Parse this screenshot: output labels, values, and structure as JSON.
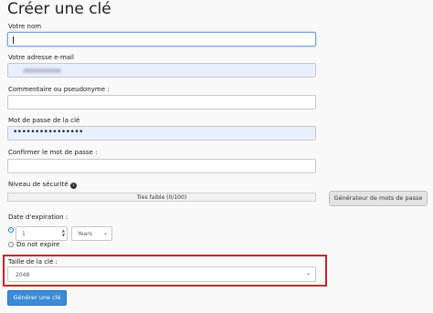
{
  "page_title": "Créer une clé",
  "name": {
    "label": "Votre nom",
    "value": ""
  },
  "email": {
    "label": "Votre adresse e-mail"
  },
  "comment": {
    "label": "Commentaire ou pseudonyme :",
    "value": ""
  },
  "passphrase": {
    "label": "Mot de passe de la clé",
    "masked": "••••••••••••••••"
  },
  "confirm": {
    "label": "Confirmer le mot de passe :",
    "value": ""
  },
  "security": {
    "label": "Niveau de sécurité",
    "info_icon": "info-icon",
    "strength_text": "Tres faible (0/100)",
    "strength_percent": 0,
    "generator_button": "Générateur de mots de passe"
  },
  "expiration": {
    "label": "Date d'expiration :",
    "radio_selected": "date",
    "amount": "1",
    "unit": "Years",
    "no_expire_label": "Do not expire"
  },
  "key_size": {
    "label": "Taille de la clé :",
    "value": "2048"
  },
  "submit_button": "Générer une clé",
  "colors": {
    "highlight": "#d32027",
    "primary": "#3b8bd6",
    "filled": "#e8f0fe"
  }
}
